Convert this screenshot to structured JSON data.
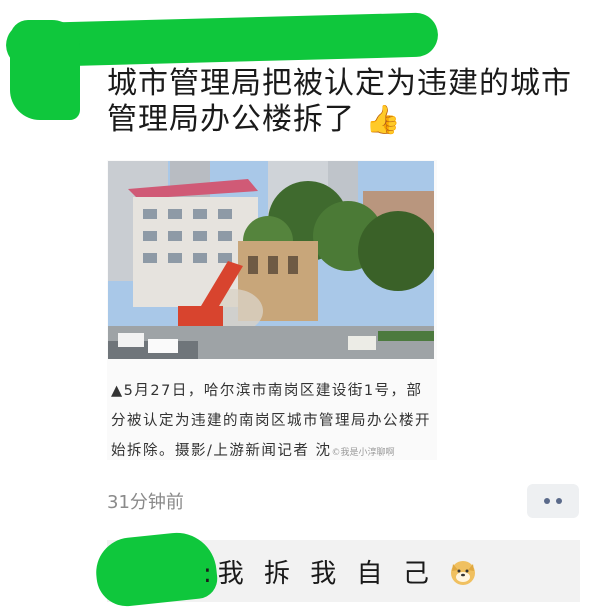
{
  "post": {
    "text": "城市管理局把被认定为违建的城市管理局办公楼拆了",
    "emoji": "👍",
    "time": "31分钟前"
  },
  "shared_article": {
    "caption": "▲5月27日，哈尔滨市南岗区建设街1号，部分被认定为违建的南岗区城市管理局办公楼开始拆除。摄影/上游新闻记者 沈",
    "watermark": "©我是小淳聊啊"
  },
  "comment": {
    "text": ":我 拆 我 自 己",
    "emoji": "doge-emoji"
  },
  "colors": {
    "redaction": "#0fc73c",
    "dots": "#5a6a8a"
  },
  "icons": [
    "thumbs-up-icon",
    "more-dots-icon",
    "doge-icon"
  ]
}
